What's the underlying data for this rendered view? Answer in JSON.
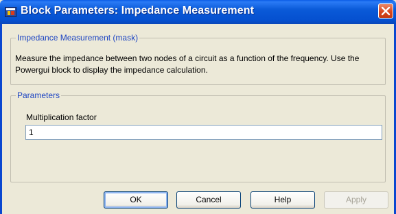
{
  "window": {
    "title": "Block Parameters: Impedance Measurement",
    "titlebar_color": "#0a5ad8",
    "app_icon": "simulink-block-icon",
    "close_icon": "close-icon"
  },
  "mask_group": {
    "legend": "Impedance Measurement (mask)",
    "description": "Measure the impedance between two nodes of a circuit as a function of the frequency. Use the Powergui block to display the impedance calculation."
  },
  "parameters_group": {
    "legend": "Parameters",
    "fields": [
      {
        "label": "Multiplication factor",
        "value": "1"
      }
    ]
  },
  "buttons": {
    "ok": "OK",
    "cancel": "Cancel",
    "help": "Help",
    "apply": "Apply"
  },
  "colors": {
    "dialog_bg": "#ece9d8",
    "legend_text": "#1c44c2",
    "close_button": "#d8471f"
  }
}
